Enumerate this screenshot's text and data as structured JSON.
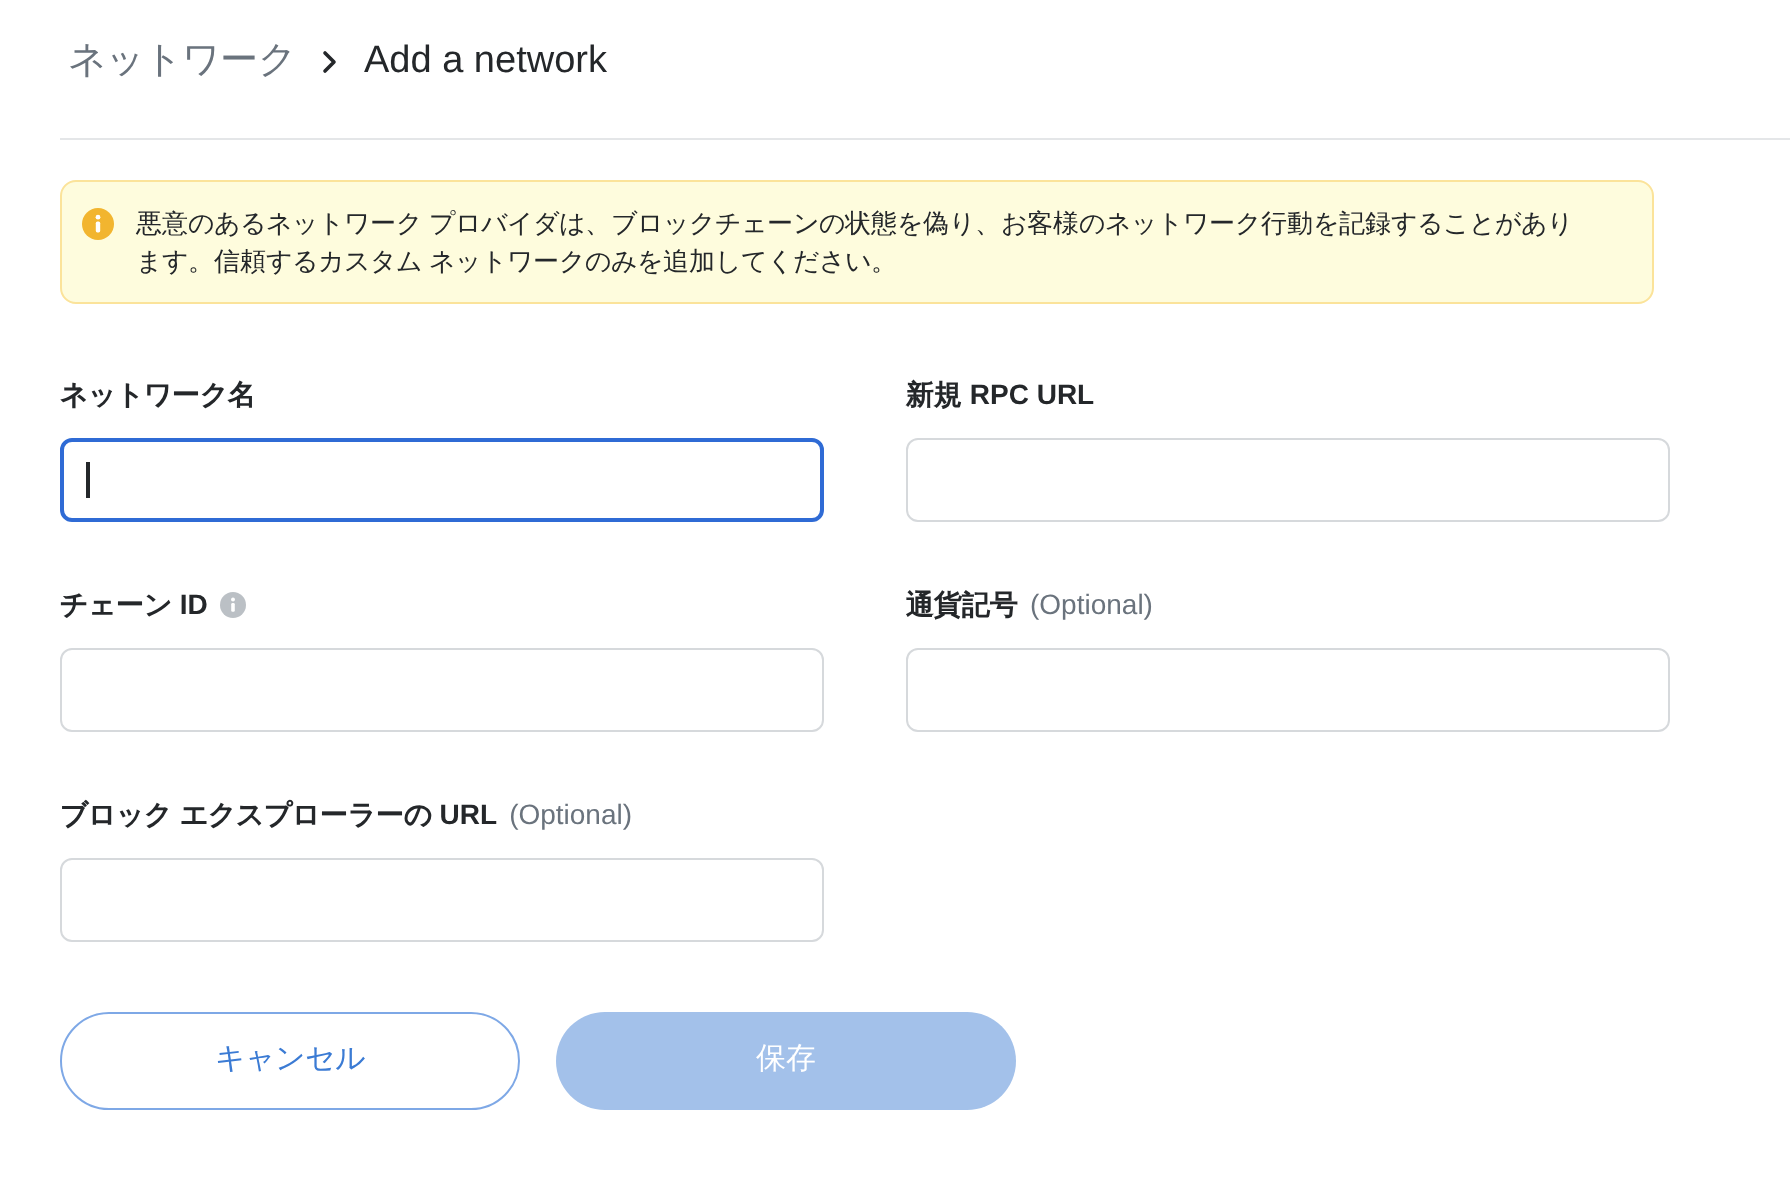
{
  "breadcrumb": {
    "parent": "ネットワーク",
    "current": "Add a network"
  },
  "warning": {
    "text": "悪意のあるネットワーク プロバイダは、ブロックチェーンの状態を偽り、お客様のネットワーク行動を記録することがあります。信頼するカスタム ネットワークのみを追加してください。"
  },
  "fields": [
    {
      "label": "ネットワーク名",
      "info": false,
      "focused": true
    },
    {
      "label": "新規 RPC URL",
      "info": false,
      "focused": false
    },
    {
      "label": "チェーン ID",
      "info": true,
      "focused": false
    },
    {
      "label": "通貨記号",
      "optional": "(Optional)",
      "info": false,
      "focused": false
    },
    {
      "label": "ブロック エクスプローラーの URL",
      "optional": "(Optional)",
      "info": false,
      "focused": false
    }
  ],
  "buttons": [
    {
      "label": "キャンセル",
      "kind": "secondary",
      "disabled": false
    },
    {
      "label": "保存",
      "kind": "primary",
      "disabled": true
    }
  ]
}
